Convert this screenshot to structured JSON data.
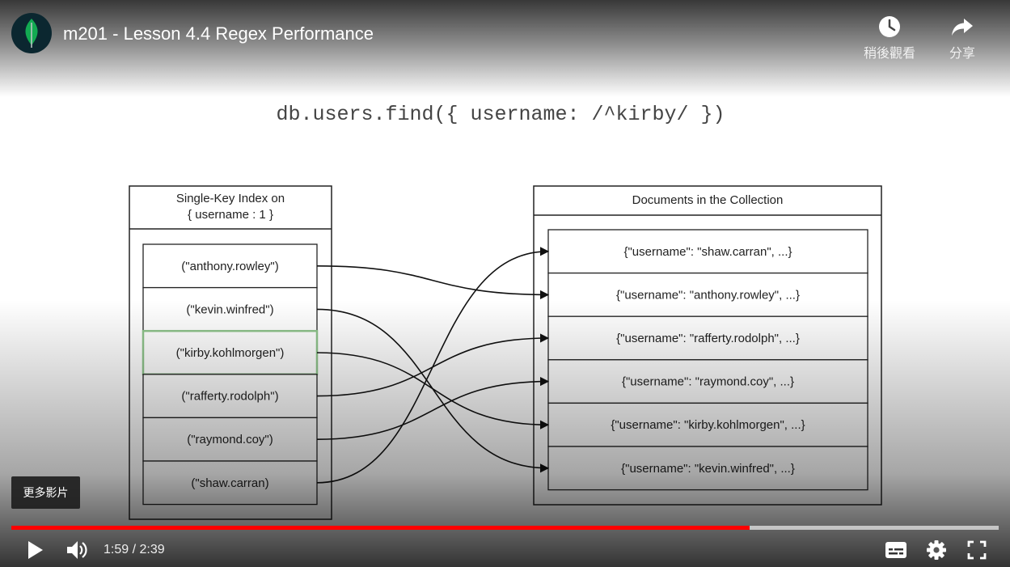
{
  "header": {
    "title": "m201 - Lesson 4.4 Regex Performance",
    "watch_later_label": "稍後觀看",
    "share_label": "分享"
  },
  "slide": {
    "query": "db.users.find({ username: /^kirby/ })",
    "index_box": {
      "title_line1": "Single-Key Index on",
      "title_line2": "{ username : 1 }",
      "entries": [
        "(\"anthony.rowley\")",
        "(\"kevin.winfred\")",
        "(\"kirby.kohlmorgen\")",
        "(\"rafferty.rodolph\")",
        "(\"raymond.coy\")",
        "(\"shaw.carran)"
      ]
    },
    "documents_box": {
      "title": "Documents in the Collection",
      "documents": [
        "{\"username\": \"shaw.carran\", ...}",
        "{\"username\": \"anthony.rowley\", ...}",
        "{\"username\": \"rafferty.rodolph\", ...}",
        "{\"username\": \"raymond.coy\", ...}",
        "{\"username\": \"kirby.kohlmorgen\", ...}",
        "{\"username\": \"kevin.winfred\", ...}"
      ]
    },
    "highlight_color": "#8fc48c",
    "connections": [
      [
        0,
        1
      ],
      [
        1,
        5
      ],
      [
        2,
        4
      ],
      [
        3,
        2
      ],
      [
        4,
        3
      ],
      [
        5,
        0
      ]
    ]
  },
  "overlay": {
    "more_videos_label": "更多影片"
  },
  "controls": {
    "time": "1:59 / 2:39",
    "progress_fraction": 0.748,
    "buffered_fraction": 1.0,
    "progress_color": "#ff0000"
  },
  "icons": {
    "logo": "mongodb-leaf-icon",
    "watch_later": "clock-icon",
    "share": "share-arrow-icon",
    "play": "play-icon",
    "volume": "volume-icon",
    "subtitles": "subtitles-icon",
    "settings": "gear-icon",
    "fullscreen": "fullscreen-icon"
  }
}
